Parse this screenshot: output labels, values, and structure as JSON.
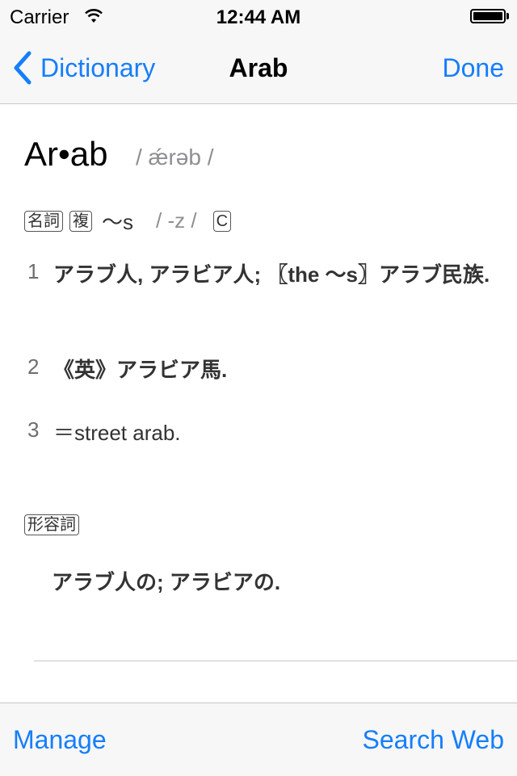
{
  "status_bar": {
    "carrier": "Carrier",
    "time": "12:44 AM"
  },
  "nav": {
    "back_label": "Dictionary",
    "title": "Arab",
    "done_label": "Done"
  },
  "entry": {
    "headword": "Ar•ab",
    "pronunciation": "/ ǽrəb /",
    "noun": {
      "pos_label": "名詞",
      "plural_label": "複",
      "plural_form": "〜s",
      "plural_pron": "/ -z /",
      "countable_label": "C",
      "senses": [
        {
          "num": "1",
          "text": "アラブ人, アラビア人; 〖the 〜s〗アラブ民族."
        },
        {
          "num": "2",
          "text": "《英》アラビア馬."
        },
        {
          "num": "3",
          "text": "＝street arab."
        }
      ]
    },
    "adjective": {
      "pos_label": "形容詞",
      "definition": "アラブ人の; アラビアの."
    }
  },
  "toolbar": {
    "manage_label": "Manage",
    "search_web_label": "Search Web"
  },
  "colors": {
    "accent": "#157efb",
    "bar_background": "#f7f7f7",
    "separator": "#c8c8cc",
    "secondary_text": "#8e8e93"
  }
}
